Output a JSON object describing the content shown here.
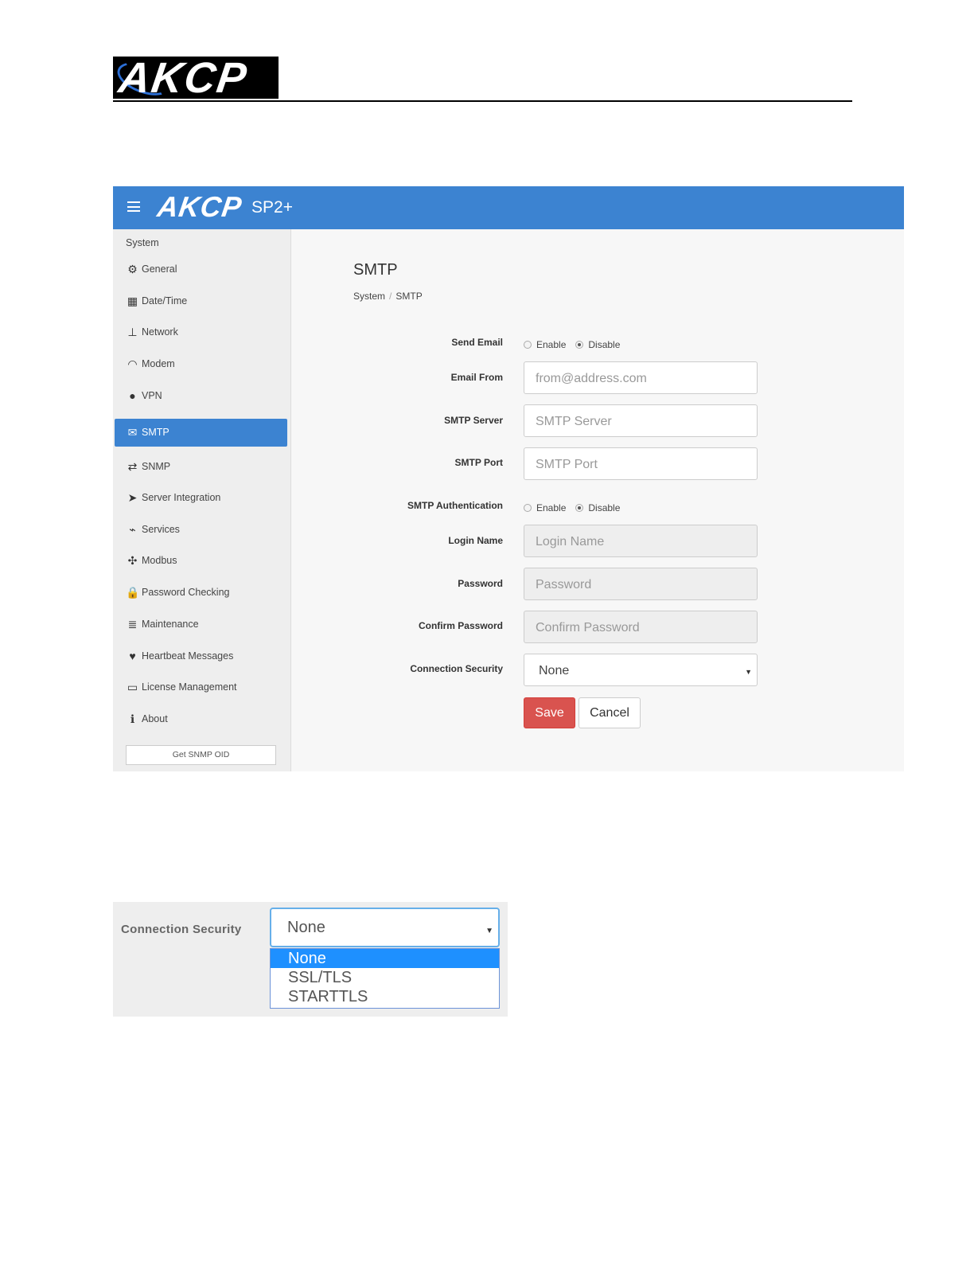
{
  "document": {
    "logo_text": "AKCP"
  },
  "app": {
    "logo_text": "AKCP",
    "model": "SP2+",
    "accent_color": "#3c83d1"
  },
  "sidebar": {
    "heading": "System",
    "items": [
      {
        "label": "General",
        "icon": "gears-icon"
      },
      {
        "label": "Date/Time",
        "icon": "calendar-icon"
      },
      {
        "label": "Network",
        "icon": "sitemap-icon"
      },
      {
        "label": "Modem",
        "icon": "wifi-icon"
      },
      {
        "label": "VPN",
        "icon": "globe-icon"
      },
      {
        "label": "SMTP",
        "icon": "envelope-icon",
        "active": true
      },
      {
        "label": "SNMP",
        "icon": "exchange-icon"
      },
      {
        "label": "Server Integration",
        "icon": "paper-plane-icon"
      },
      {
        "label": "Services",
        "icon": "rss-icon"
      },
      {
        "label": "Modbus",
        "icon": "modbus-icon"
      },
      {
        "label": "Password Checking",
        "icon": "lock-icon"
      },
      {
        "label": "Maintenance",
        "icon": "database-icon"
      },
      {
        "label": "Heartbeat Messages",
        "icon": "heart-icon"
      },
      {
        "label": "License Management",
        "icon": "credit-card-icon"
      },
      {
        "label": "About",
        "icon": "info-icon"
      }
    ],
    "snmp_oid_button": "Get SNMP OID"
  },
  "main": {
    "title": "SMTP",
    "breadcrumb": [
      "System",
      "SMTP"
    ],
    "send_email": {
      "label": "Send Email",
      "enable": "Enable",
      "disable": "Disable",
      "selected": "Disable"
    },
    "email_from": {
      "label": "Email From",
      "placeholder": "from@address.com"
    },
    "smtp_server": {
      "label": "SMTP Server",
      "placeholder": "SMTP Server"
    },
    "smtp_port": {
      "label": "SMTP Port",
      "placeholder": "SMTP Port"
    },
    "smtp_auth": {
      "label": "SMTP Authentication",
      "enable": "Enable",
      "disable": "Disable",
      "selected": "Disable"
    },
    "login_name": {
      "label": "Login Name",
      "placeholder": "Login Name"
    },
    "password": {
      "label": "Password",
      "placeholder": "Password"
    },
    "confirm_password": {
      "label": "Confirm Password",
      "placeholder": "Confirm Password"
    },
    "connection_security": {
      "label": "Connection Security",
      "value": "None"
    },
    "save_label": "Save",
    "cancel_label": "Cancel"
  },
  "dropdown_detail": {
    "label": "Connection Security",
    "value": "None",
    "options": [
      "None",
      "SSL/TLS",
      "STARTTLS"
    ],
    "selected": "None"
  }
}
